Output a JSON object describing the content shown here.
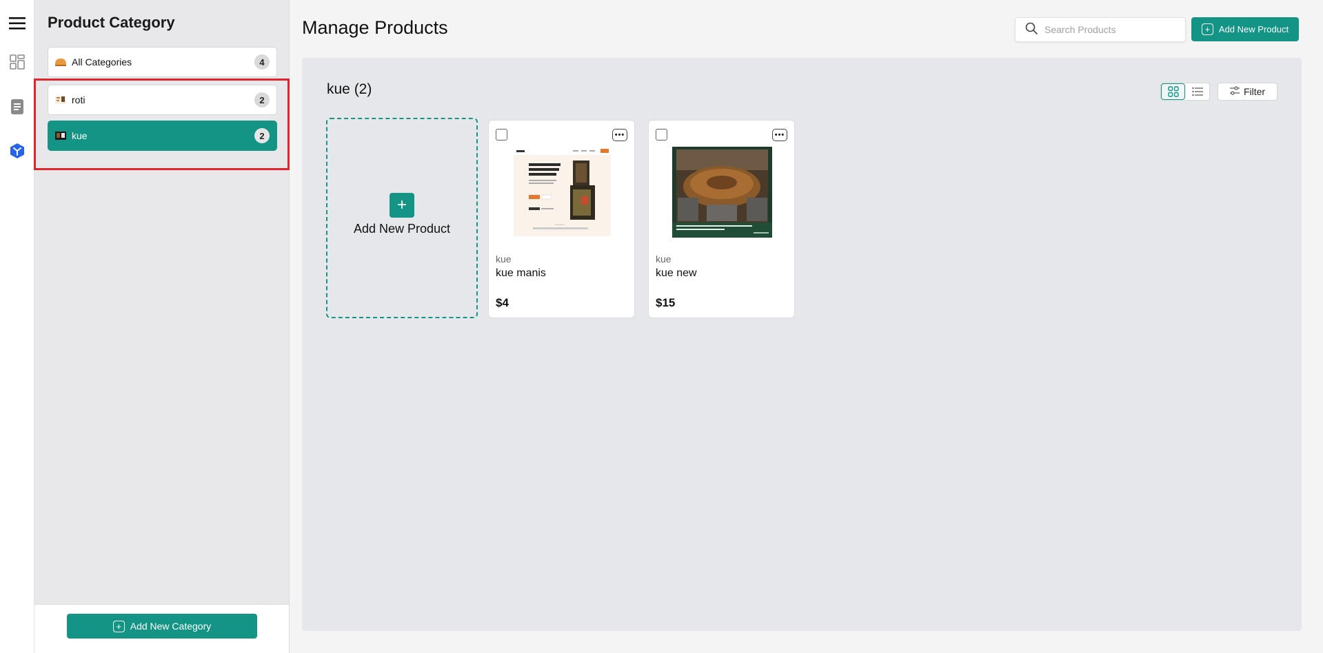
{
  "sidebar_rail": {
    "icons": [
      "menu-icon",
      "dashboard-icon",
      "document-icon",
      "product-cube-icon"
    ]
  },
  "category_panel": {
    "title": "Product Category",
    "items": [
      {
        "name": "All Categories",
        "count": "4",
        "active": false,
        "icon": "bread-icon"
      },
      {
        "name": "roti",
        "count": "2",
        "active": false,
        "icon": "category-thumbnail"
      },
      {
        "name": "kue",
        "count": "2",
        "active": true,
        "icon": "category-thumbnail"
      }
    ],
    "add_button": "Add New Category"
  },
  "header": {
    "title": "Manage Products",
    "search_placeholder": "Search Products",
    "add_button": "Add New Product"
  },
  "content": {
    "group_title": "kue (2)",
    "filter_label": "Filter",
    "add_tile_label": "Add New Product",
    "products": [
      {
        "category": "kue",
        "name": "kue manis",
        "price": "$4"
      },
      {
        "category": "kue",
        "name": "kue new",
        "price": "$15"
      }
    ]
  },
  "colors": {
    "accent": "#139485",
    "highlight": "#e0262b"
  }
}
